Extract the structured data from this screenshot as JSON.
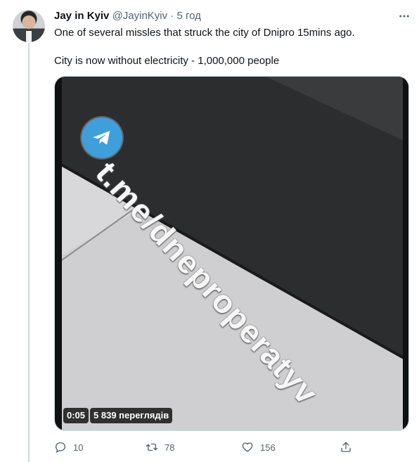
{
  "tweet": {
    "author_name": "Jay in Kyiv",
    "author_handle": "@JayinKyiv",
    "separator": "·",
    "time": "5 год",
    "line1": "One of several missles that struck the city of Dnipro 15mins ago.",
    "line2": "City is now without electricity - 1,000,000 people",
    "more_icon": "more-dots-icon"
  },
  "video": {
    "watermark": "t.me/dneproperatyv",
    "logo_icon": "telegram-icon",
    "duration": "0:05",
    "views": "5 839 переглядів"
  },
  "actions": {
    "reply_count": "10",
    "retweet_count": "78",
    "like_count": "156",
    "share_icon": "share-icon"
  },
  "colors": {
    "text": "#0f1419",
    "secondary": "#536471",
    "border": "#cfd9de",
    "telegram": "#3f9fdb"
  }
}
